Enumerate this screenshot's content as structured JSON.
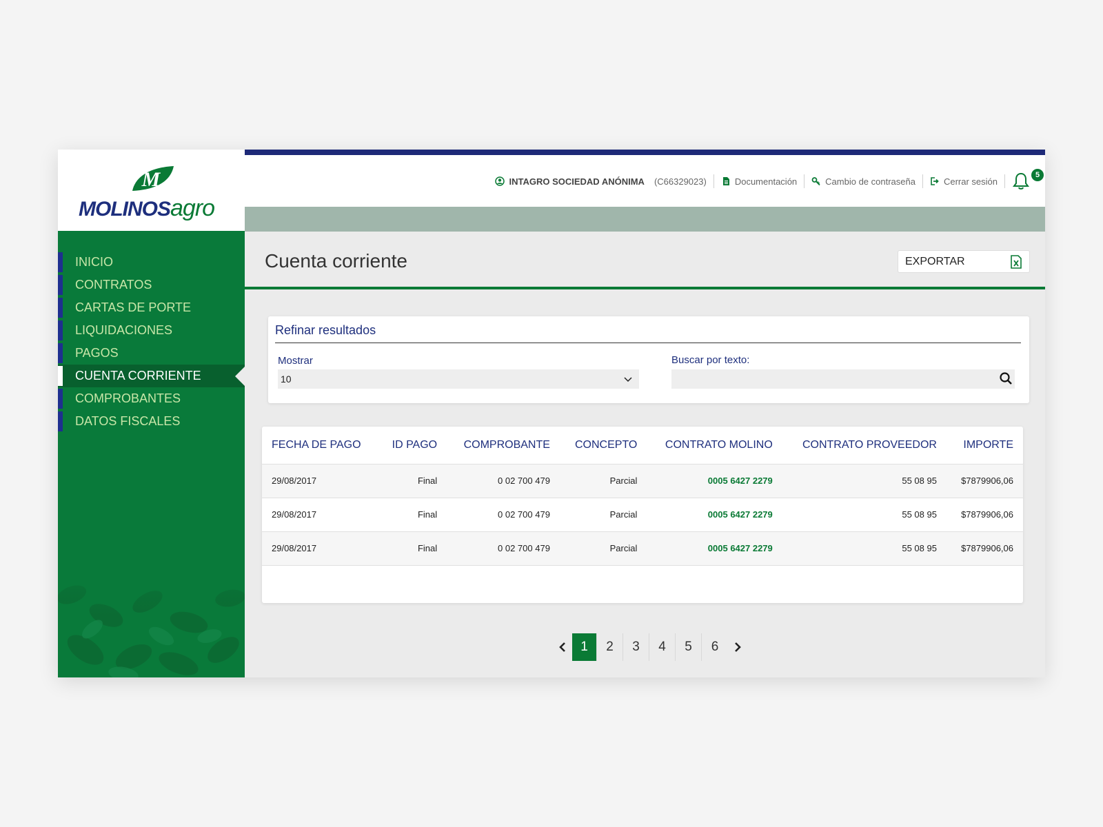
{
  "brand": {
    "name_part1": "MOLINOS",
    "name_part2": "agro",
    "mark_letter": "M"
  },
  "header": {
    "company": "INTAGRO SOCIEDAD ANÓNIMA",
    "company_id": "(C66329023)",
    "links": [
      {
        "label": "Documentación",
        "icon": "document-icon"
      },
      {
        "label": "Cambio de contraseña",
        "icon": "key-icon"
      },
      {
        "label": "Cerrar sesión",
        "icon": "logout-icon"
      }
    ],
    "notifications_count": "5"
  },
  "sidebar": {
    "items": [
      {
        "label": "INICIO"
      },
      {
        "label": "CONTRATOS"
      },
      {
        "label": "CARTAS DE PORTE"
      },
      {
        "label": "LIQUIDACIONES"
      },
      {
        "label": "PAGOS"
      },
      {
        "label": "CUENTA CORRIENTE",
        "active": true
      },
      {
        "label": "COMPROBANTES"
      },
      {
        "label": "DATOS FISCALES"
      }
    ]
  },
  "page": {
    "title": "Cuenta corriente",
    "export_label": "EXPORTAR"
  },
  "filter": {
    "title": "Refinar resultados",
    "show_label": "Mostrar",
    "show_value": "10",
    "search_label": "Buscar por texto:",
    "search_value": ""
  },
  "table": {
    "headers": [
      "FECHA DE PAGO",
      "ID PAGO",
      "COMPROBANTE",
      "CONCEPTO",
      "CONTRATO MOLINO",
      "CONTRATO PROVEEDOR",
      "IMPORTE"
    ],
    "rows": [
      [
        "29/08/2017",
        "Final",
        "0 02 700 479",
        "Parcial",
        "0005 6427 2279",
        "55 08 95",
        "$7879906,06"
      ],
      [
        "29/08/2017",
        "Final",
        "0 02 700 479",
        "Parcial",
        "0005 6427 2279",
        "55 08 95",
        "$7879906,06"
      ],
      [
        "29/08/2017",
        "Final",
        "0 02 700 479",
        "Parcial",
        "0005 6427 2279",
        "55 08 95",
        "$7879906,06"
      ]
    ]
  },
  "pagination": {
    "pages": [
      "1",
      "2",
      "3",
      "4",
      "5",
      "6"
    ],
    "current": "1"
  },
  "colors": {
    "green": "#0a7a35",
    "navy": "#1e2f7d",
    "sidebar": "#097a3a"
  }
}
